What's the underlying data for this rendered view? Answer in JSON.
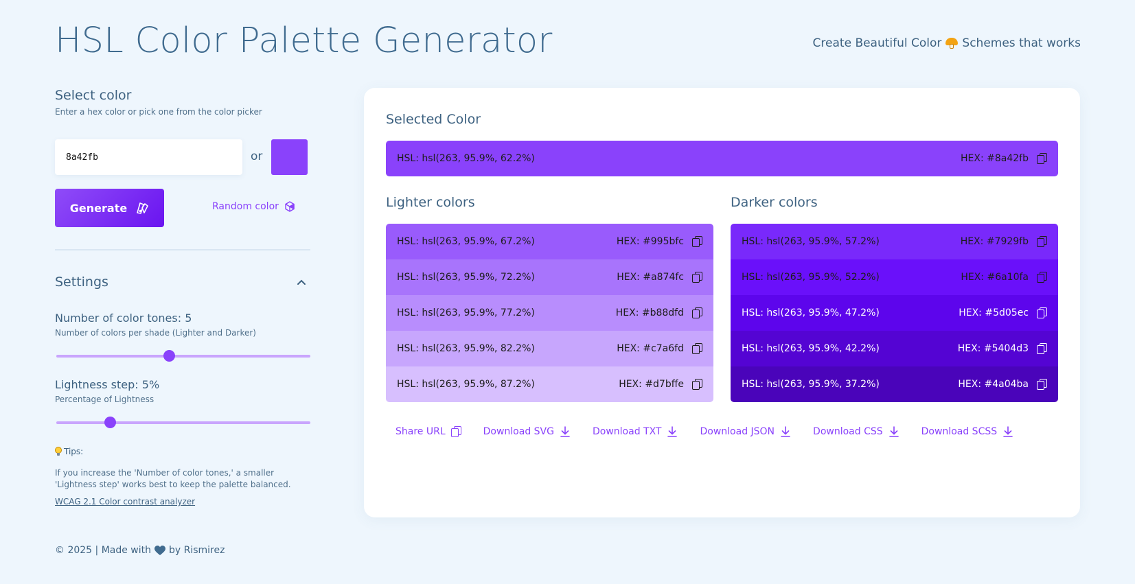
{
  "header": {
    "title": "HSL Color Palette Generator",
    "tagline_before": "Create Beautiful Color",
    "tagline_after": "Schemes that works"
  },
  "select": {
    "title": "Select color",
    "subtitle": "Enter a hex color or pick one from the color picker",
    "hex_value": "8a42fb",
    "or_label": "or",
    "swatch_color": "#8a42fb",
    "generate_label": "Generate",
    "random_label": "Random color"
  },
  "settings": {
    "title": "Settings",
    "tones_label": "Number of color tones: 5",
    "tones_sub": "Number of colors per shade (Lighter and Darker)",
    "tones_value": 5,
    "step_label": "Lightness step: 5%",
    "step_sub": "Percentage of Lightness",
    "step_value": 5
  },
  "tips": {
    "title": "Tips:",
    "text": "If you increase the 'Number of color tones,' a smaller 'Lightness step' works best to keep the palette balanced.",
    "link": "WCAG 2.1 Color contrast analyzer"
  },
  "footer": {
    "before": "© 2025 | Made with",
    "after": "by Rismirez"
  },
  "palette": {
    "selected_title": "Selected Color",
    "selected": {
      "hsl": "HSL: hsl(263, 95.9%, 62.2%)",
      "hex": "HEX: #8a42fb",
      "color": "#8a42fb",
      "text": "#1d1d1d"
    },
    "lighter_title": "Lighter colors",
    "darker_title": "Darker colors",
    "lighter": [
      {
        "hsl": "HSL: hsl(263, 95.9%, 67.2%)",
        "hex": "HEX: #995bfc",
        "color": "#995bfc",
        "text": "#1d1d1d"
      },
      {
        "hsl": "HSL: hsl(263, 95.9%, 72.2%)",
        "hex": "HEX: #a874fc",
        "color": "#a874fc",
        "text": "#1d1d1d"
      },
      {
        "hsl": "HSL: hsl(263, 95.9%, 77.2%)",
        "hex": "HEX: #b88dfd",
        "color": "#b88dfd",
        "text": "#1d1d1d"
      },
      {
        "hsl": "HSL: hsl(263, 95.9%, 82.2%)",
        "hex": "HEX: #c7a6fd",
        "color": "#c7a6fd",
        "text": "#1d1d1d"
      },
      {
        "hsl": "HSL: hsl(263, 95.9%, 87.2%)",
        "hex": "HEX: #d7bffe",
        "color": "#d7bffe",
        "text": "#1d1d1d"
      }
    ],
    "darker": [
      {
        "hsl": "HSL: hsl(263, 95.9%, 57.2%)",
        "hex": "HEX: #7929fb",
        "color": "#7929fb",
        "text": "#1d1d1d"
      },
      {
        "hsl": "HSL: hsl(263, 95.9%, 52.2%)",
        "hex": "HEX: #6a10fa",
        "color": "#6a10fa",
        "text": "#1d1d1d"
      },
      {
        "hsl": "HSL: hsl(263, 95.9%, 47.2%)",
        "hex": "HEX: #5d05ec",
        "color": "#5d05ec",
        "text": "#ffffff"
      },
      {
        "hsl": "HSL: hsl(263, 95.9%, 42.2%)",
        "hex": "HEX: #5404d3",
        "color": "#5404d3",
        "text": "#ffffff"
      },
      {
        "hsl": "HSL: hsl(263, 95.9%, 37.2%)",
        "hex": "HEX: #4a04ba",
        "color": "#4a04ba",
        "text": "#ffffff"
      }
    ]
  },
  "actions": [
    {
      "label": "Share URL",
      "icon": "copy-icon"
    },
    {
      "label": "Download SVG",
      "icon": "download-icon"
    },
    {
      "label": "Download TXT",
      "icon": "download-icon"
    },
    {
      "label": "Download JSON",
      "icon": "download-icon"
    },
    {
      "label": "Download CSS",
      "icon": "download-icon"
    },
    {
      "label": "Download SCSS",
      "icon": "download-icon"
    }
  ],
  "colors": {
    "accent": "#8a42fb",
    "heading": "#406b8f",
    "background": "#eef6fd"
  }
}
